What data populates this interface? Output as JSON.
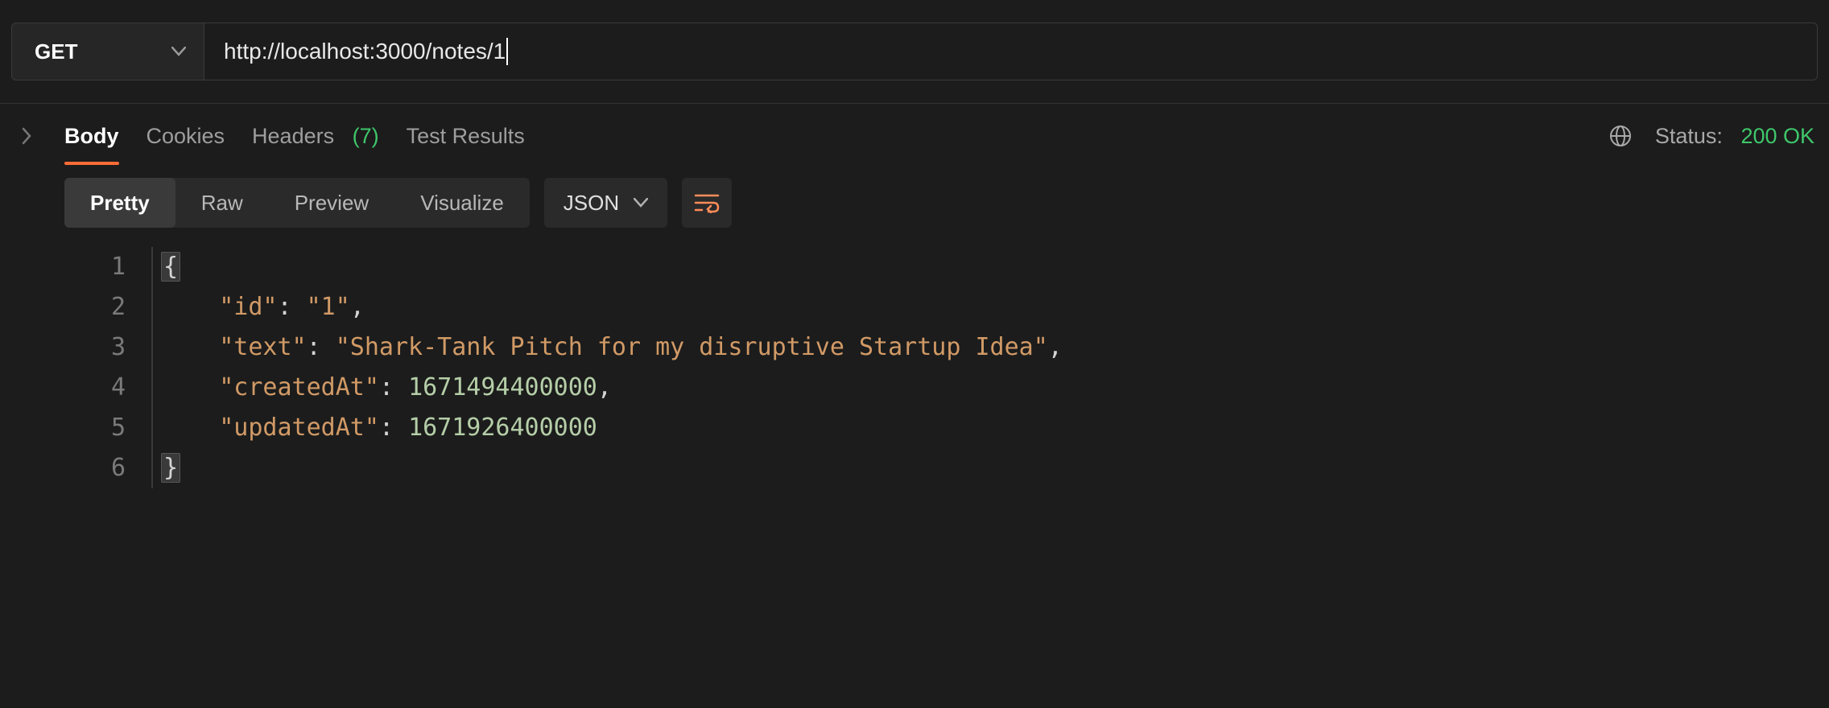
{
  "request": {
    "method": "GET",
    "url": "http://localhost:3000/notes/1"
  },
  "response_tabs": {
    "body": "Body",
    "cookies": "Cookies",
    "headers_label": "Headers",
    "headers_count": "(7)",
    "test_results": "Test Results"
  },
  "status": {
    "label": "Status:",
    "value": "200 OK"
  },
  "view_modes": {
    "pretty": "Pretty",
    "raw": "Raw",
    "preview": "Preview",
    "visualize": "Visualize"
  },
  "format": {
    "selected": "JSON"
  },
  "body": {
    "lines": {
      "l1_open": "{",
      "l2_key": "\"id\"",
      "l2_val": "\"1\"",
      "l3_key": "\"text\"",
      "l3_val": "\"Shark-Tank Pitch for my disruptive Startup Idea\"",
      "l4_key": "\"createdAt\"",
      "l4_val": "1671494400000",
      "l5_key": "\"updatedAt\"",
      "l5_val": "1671926400000",
      "l6_close": "}"
    },
    "line_numbers": [
      "1",
      "2",
      "3",
      "4",
      "5",
      "6"
    ]
  }
}
